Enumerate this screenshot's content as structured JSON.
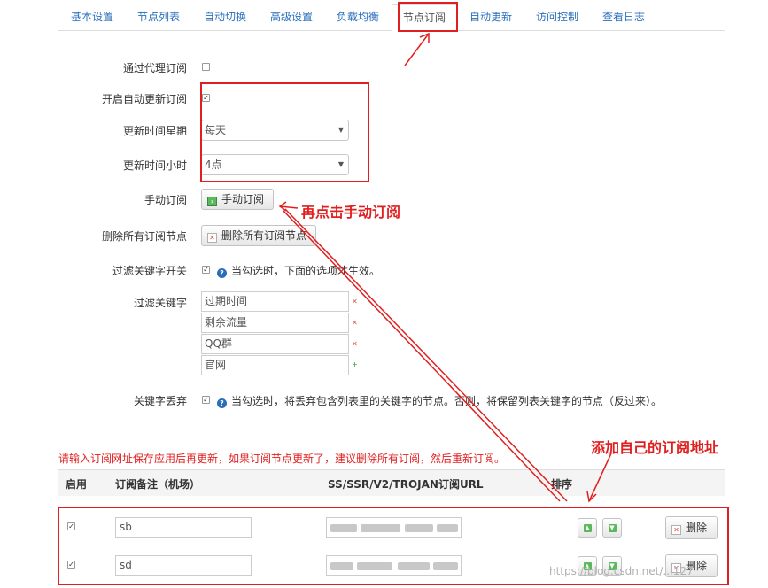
{
  "tabs": [
    "基本设置",
    "节点列表",
    "自动切换",
    "高级设置",
    "负载均衡",
    "节点订阅",
    "自动更新",
    "访问控制",
    "查看日志"
  ],
  "active_tab": "节点订阅",
  "form": {
    "proxy_subscribe_label": "通过代理订阅",
    "auto_update_label": "开启自动更新订阅",
    "weekday_label": "更新时间星期",
    "weekday_value": "每天",
    "hour_label": "更新时间小时",
    "hour_value": "4点",
    "manual_label": "手动订阅",
    "manual_button": "手动订阅",
    "delete_all_label": "删除所有订阅节点",
    "delete_all_button": "删除所有订阅节点",
    "filter_switch_label": "过滤关键字开关",
    "filter_switch_hint": "当勾选时，下面的选项才生效。",
    "filter_keywords_label": "过滤关键字",
    "filter_keywords": [
      "过期时间",
      "剩余流量",
      "QQ群",
      "官网"
    ],
    "discard_label": "关键字丢弃",
    "discard_hint": "当勾选时，将丢弃包含列表里的关键字的节点。否则，将保留列表关键字的节点（反过来）。"
  },
  "notice": "请输入订阅网址保存应用后再更新，如果订阅节点更新了，建议删除所有订阅，然后重新订阅。",
  "table": {
    "headers": [
      "启用",
      "订阅备注（机场）",
      "SS/SSR/V2/TROJAN订阅URL",
      "排序"
    ],
    "rows": [
      {
        "enabled": true,
        "remark": "sb"
      },
      {
        "enabled": true,
        "remark": "sd"
      }
    ],
    "delete_label": "删除"
  },
  "annotations": {
    "manual_click": "再点击手动订阅",
    "add_address": "添加自己的订阅地址"
  },
  "watermark": "https://blog.csdn.net/...127",
  "colors": {
    "accent": "#2a6ebb",
    "annotation": "#e02020",
    "ok": "#5cb85c"
  }
}
